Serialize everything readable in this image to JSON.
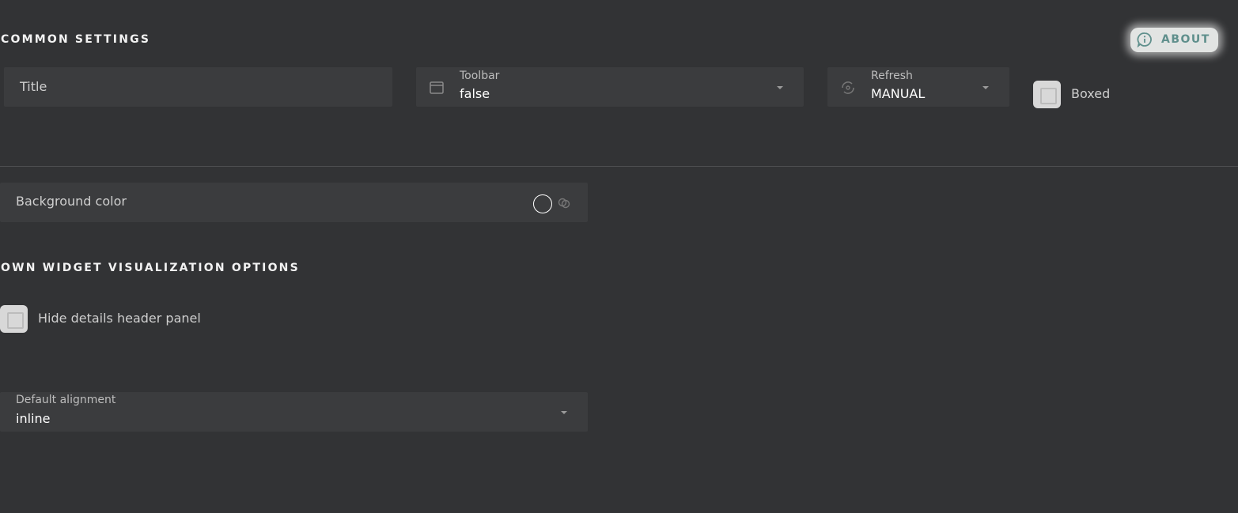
{
  "common_settings": {
    "heading": "COMMON SETTINGS",
    "about_label": "ABOUT",
    "title_placeholder": "Title",
    "toolbar": {
      "label": "Toolbar",
      "value": "false"
    },
    "refresh": {
      "label": "Refresh",
      "value": "MANUAL"
    },
    "boxed_label": "Boxed"
  },
  "background": {
    "label": "Background color"
  },
  "own_options": {
    "heading": "OWN WIDGET VISUALIZATION OPTIONS",
    "hide_header_label": "Hide details header panel",
    "alignment": {
      "label": "Default alignment",
      "value": "inline"
    }
  },
  "colors": {
    "accent": "#5f8f8c",
    "field_bg": "#3b3c3e",
    "page_bg": "#323335"
  }
}
